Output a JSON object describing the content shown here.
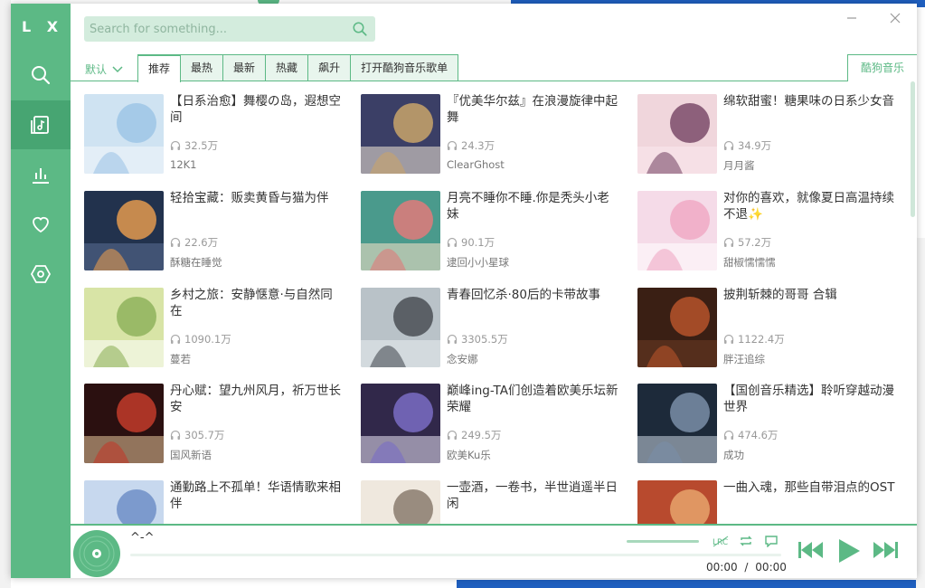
{
  "app": {
    "logo": "L X"
  },
  "search": {
    "placeholder": "Search for something..."
  },
  "colors": {
    "accent": "#5cb985",
    "accent_dark": "#47a572",
    "tab_bg": "#e8f5ed",
    "search_bg": "#d3ecdd"
  },
  "sidebar": {
    "items": [
      {
        "name": "search",
        "icon": "search-icon"
      },
      {
        "name": "songlist",
        "icon": "music-list-icon",
        "active": true
      },
      {
        "name": "leaderboard",
        "icon": "chart-icon"
      },
      {
        "name": "favorites",
        "icon": "heart-icon"
      },
      {
        "name": "settings",
        "icon": "settings-icon"
      }
    ]
  },
  "tabs": {
    "sort_label": "默认",
    "items": [
      "推荐",
      "最热",
      "最新",
      "热藏",
      "飙升",
      "打开酷狗音乐歌单"
    ],
    "active": "推荐",
    "source": "酷狗音乐"
  },
  "playlists": [
    {
      "title": "【日系治愈】舞樱の岛，遐想空间",
      "plays": "32.5万",
      "author": "12K1"
    },
    {
      "title": "『优美华尔兹』在浪漫旋律中起舞",
      "plays": "24.3万",
      "author": "ClearGhost"
    },
    {
      "title": "绵软甜蜜！糖果味の日系少女音",
      "plays": "34.9万",
      "author": "月月酱"
    },
    {
      "title": "轻拾宝藏：贩卖黄昏与猫为伴",
      "plays": "22.6万",
      "author": "酥糖在睡觉"
    },
    {
      "title": "月亮不睡你不睡.你是秃头小老妹",
      "plays": "90.1万",
      "author": "逮回小小星球"
    },
    {
      "title": "对你的喜欢，就像夏日高温持续不退✨",
      "plays": "57.2万",
      "author": "甜椒懦懦懦"
    },
    {
      "title": "乡村之旅：安静惬意·与自然同在",
      "plays": "1090.1万",
      "author": "蔓若"
    },
    {
      "title": "青春回忆杀·80后的卡带故事",
      "plays": "3305.5万",
      "author": "念安娜"
    },
    {
      "title": "披荆斩棘的哥哥 合辑",
      "plays": "1122.4万",
      "author": "胖汪追综"
    },
    {
      "title": "丹心赋：望九州风月，祈万世长安",
      "plays": "305.7万",
      "author": "国风新语"
    },
    {
      "title": "巅峰ing-TA们创造着欧美乐坛新荣耀",
      "plays": "249.5万",
      "author": "欧美Ku乐"
    },
    {
      "title": "【国创音乐精选】聆听穿越动漫世界",
      "plays": "474.6万",
      "author": "成功"
    },
    {
      "title": "通勤路上不孤单！华语情歌来相伴",
      "plays": "",
      "author": ""
    },
    {
      "title": "一壶酒，一卷书，半世逍遥半日闲",
      "plays": "",
      "author": ""
    },
    {
      "title": "一曲入魂，那些自带泪点的OST",
      "plays": "",
      "author": ""
    }
  ],
  "player": {
    "title": "^-^",
    "current_time": "00:00",
    "separator": "/",
    "total_time": "00:00",
    "lyric_label": "LRC",
    "progress": 0
  }
}
